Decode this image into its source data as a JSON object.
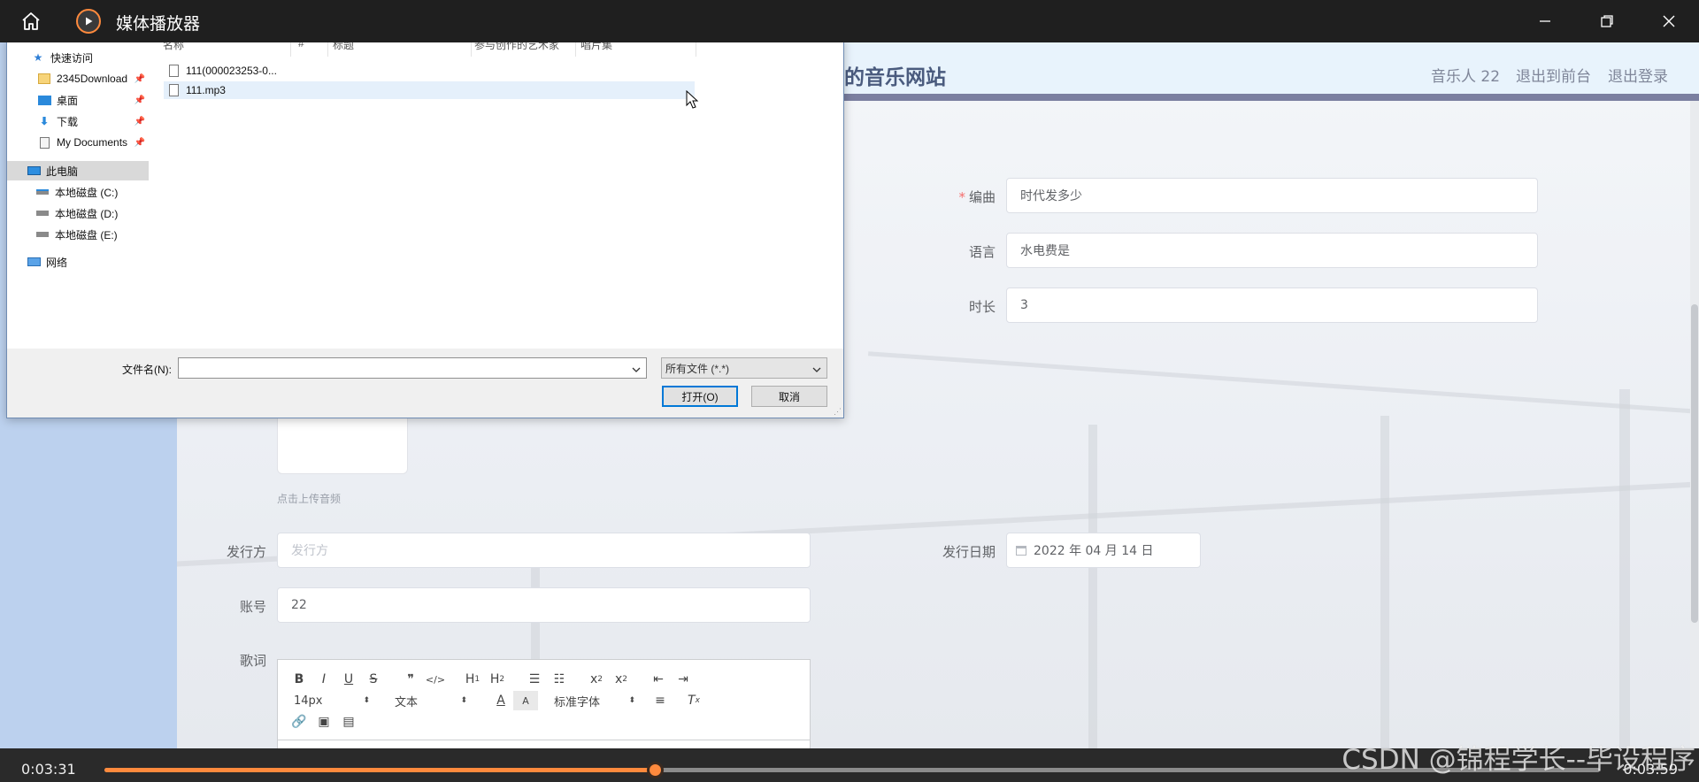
{
  "player": {
    "title": "媒体播放器",
    "time_elapsed": "0:03:31",
    "time_total": "0:03:59",
    "progress_fraction": 0.368,
    "accent_color": "#ff8a3d"
  },
  "website": {
    "title_fragment": "的音乐网站",
    "nav": [
      "音乐人 22",
      "退出到前台",
      "退出登录"
    ],
    "form": {
      "arranger_label": "编曲",
      "arranger_value": "时代发多少",
      "language_label": "语言",
      "language_value": "水电费是",
      "duration_label": "时长",
      "duration_value": "3",
      "upload_hint": "点击上传音频",
      "publisher_label": "发行方",
      "publisher_placeholder": "发行方",
      "release_date_label": "发行日期",
      "release_date_value": "2022 年 04 月 14 日",
      "account_label": "账号",
      "account_value": "22",
      "lyrics_label": "歌词"
    },
    "editor_toolbar": {
      "row1": [
        "B",
        "I",
        "U",
        "S",
        "❞",
        "</>",
        "H1",
        "H2",
        "OL",
        "UL",
        "x2-sub",
        "x2-sup",
        "outdent",
        "indent"
      ],
      "font_size": "14px",
      "text_style": "文本",
      "font_family": "标准字体"
    }
  },
  "dialog": {
    "nav": {
      "quick_access": "快速访问",
      "items": [
        "2345Download",
        "桌面",
        "下载",
        "My Documents"
      ],
      "this_pc": "此电脑",
      "drives": [
        "本地磁盘 (C:)",
        "本地磁盘 (D:)",
        "本地磁盘 (E:)"
      ],
      "network": "网络"
    },
    "columns": [
      "名称",
      "#",
      "标题",
      "参与创作的艺术家",
      "唱片集"
    ],
    "files": [
      "111(000023253-0...",
      "111.mp3"
    ],
    "filename_label": "文件名(N):",
    "filename_value": "",
    "filetype_value": "所有文件 (*.*)",
    "open_button": "打开(O)",
    "cancel_button": "取消"
  },
  "watermark": "CSDN @锦程学长--毕设程序"
}
